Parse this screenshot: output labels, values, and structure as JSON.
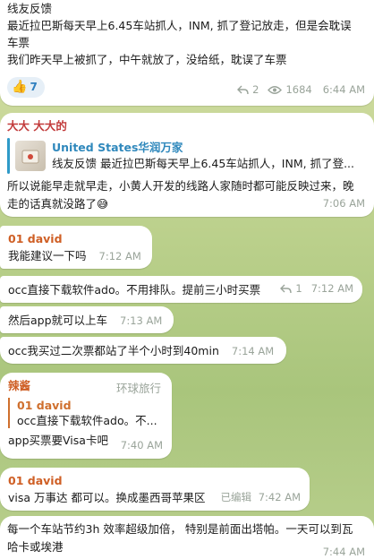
{
  "top_message": {
    "line1": "线友反馈",
    "line2": "最近拉巴斯每天早上6.45车站抓人，INM, 抓了登记放走，但是会耽误",
    "line3": "车票",
    "line4": "我们昨天早上被抓了，中午就放了，没给纸，耽误了车票",
    "reaction_count": "7",
    "replies": "2",
    "views": "1684",
    "time": "6:44 AM"
  },
  "msg_dada": {
    "sender": "大大 大大的",
    "reply_name": "United States华润万家",
    "reply_text": "线友反馈 最近拉巴斯每天早上6.45车站抓人，INM, 抓了登...",
    "text_line1": "所以说能早走就早走，小黄人开发的线路人家随时都可能反映过来，晚",
    "text_line2": "走的话真就没路了😅",
    "time": "7:06 AM"
  },
  "msg_david_1": {
    "sender": "01 david",
    "text": "我能建议一下吗",
    "time": "7:12 AM"
  },
  "msg_david_2": {
    "text": "occ直接下载软件ado。不用排队。提前三小时买票",
    "replies": "1",
    "time": "7:12 AM"
  },
  "msg_david_3": {
    "text": "然后app就可以上车",
    "time": "7:13 AM"
  },
  "msg_david_4": {
    "text": "occ我买过二次票都站了半个小时到40min",
    "time": "7:14 AM"
  },
  "msg_lajiang": {
    "sender": "辣酱",
    "tag": "环球旅行",
    "reply_name": "01 david",
    "reply_text": "occ直接下载软件ado。不...",
    "text": "app买票要Visa卡吧",
    "time": "7:40 AM"
  },
  "msg_david_5": {
    "sender": "01 david",
    "text": "visa 万事达 都可以。换成墨西哥苹果区",
    "edited": "已编辑",
    "time": "7:42 AM"
  },
  "msg_last": {
    "line1": "每一个车站节约3h 效率超级加倍， 特别是前面出塔帕。一天可以到瓦",
    "line2": "哈卡或埃港",
    "time": "7:44 AM"
  },
  "colors": {
    "accent_blue": "#2f88bc",
    "sender_orange": "#cf5f25",
    "sender_red": "#c23b3b",
    "meta_gray": "#9aa49a"
  }
}
